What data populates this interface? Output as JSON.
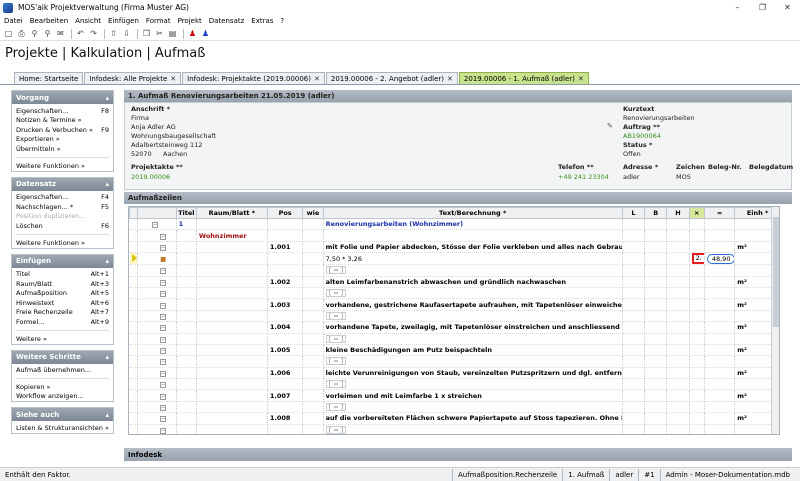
{
  "window": {
    "title": "MOS'aik Projektverwaltung (Firma Muster AG)"
  },
  "menu": [
    "Datei",
    "Bearbeiten",
    "Ansicht",
    "Einfügen",
    "Format",
    "Projekt",
    "Datensatz",
    "Extras",
    "?"
  ],
  "app_title": "Projekte | Kalkulation | Aufmaß",
  "tabs": [
    {
      "label": "Home: Startseite",
      "closable": false
    },
    {
      "label": "Infodesk: Alle Projekte",
      "closable": true
    },
    {
      "label": "Infodesk: Projektakte (2019.00006)",
      "closable": true
    },
    {
      "label": "2019.00006 - 2. Angebot (adler)",
      "closable": true
    },
    {
      "label": "2019.00006 - 1. Aufmaß (adler)",
      "closable": true
    }
  ],
  "sidebar": {
    "vorgang": {
      "title": "Vorgang",
      "items": [
        {
          "label": "Eigenschaften...",
          "key": "F8"
        },
        {
          "label": "Notizen & Termine »",
          "key": ""
        },
        {
          "label": "Drucken & Verbuchen »",
          "key": "F9"
        },
        {
          "label": "Exportieren »",
          "key": ""
        },
        {
          "label": "Übermitteln »",
          "key": ""
        }
      ],
      "more": "Weitere Funktionen »"
    },
    "datensatz": {
      "title": "Datensatz",
      "items": [
        {
          "label": "Eigenschaften...",
          "key": "F4"
        },
        {
          "label": "Nachschlagen... *",
          "key": "F5"
        },
        {
          "label": "Position duplizieren...",
          "key": ""
        },
        {
          "label": "Löschen",
          "key": "F6"
        }
      ],
      "more": "Weitere Funktionen »"
    },
    "einfuegen": {
      "title": "Einfügen",
      "items": [
        {
          "label": "Titel",
          "key": "Alt+1"
        },
        {
          "label": "Raum/Blatt",
          "key": "Alt+3"
        },
        {
          "label": "Aufmaßposition",
          "key": "Alt+5"
        },
        {
          "label": "Hinweistext",
          "key": "Alt+6"
        },
        {
          "label": "Freie Rechenzeile",
          "key": "Alt+7"
        },
        {
          "label": "Formel...",
          "key": "Alt+9"
        }
      ],
      "more": "Weitere »"
    },
    "schritte": {
      "title": "Weitere Schritte",
      "items": [
        {
          "label": "Aufmaß übernehmen..."
        },
        {
          "label": "Kopieren »"
        },
        {
          "label": "Workflow anzeigen..."
        }
      ]
    },
    "siehe": {
      "title": "Siehe auch",
      "items": [
        {
          "label": "Listen & Strukturansichten »"
        }
      ]
    }
  },
  "header_section": "1. Aufmaß Renovierungsarbeiten 21.05.2019 (adler)",
  "form": {
    "anschrift_label": "Anschrift *",
    "anschrift": [
      "Firma",
      "Anja Adler AG",
      "Wohnungsbaugesellschaft",
      "Adalbertsteinweg 112"
    ],
    "plz": "52070",
    "ort": "Aachen",
    "kurztext_label": "Kurztext",
    "kurztext": "Renovierungsarbeiten",
    "auftrag_label": "Auftrag **",
    "auftrag": "AB1900064",
    "status_label": "Status *",
    "status": "Offen",
    "projektakte_label": "Projektakte **",
    "projektakte": "2019.00006",
    "telefon_label": "Telefon **",
    "telefon": "+49 241 23304",
    "adresse_label": "Adresse *",
    "adresse": "adler",
    "zeichen_label": "Zeichen",
    "zeichen": "MOS",
    "belegnr_label": "Beleg-Nr.",
    "belegdatum_label": "Belegdatum"
  },
  "aufmass_section": "Aufmaßzeilen",
  "columns": [
    "",
    "",
    "Titel",
    "Raum/Blatt *",
    "Pos",
    "wie",
    "Text/Berechnung *",
    "L",
    "B",
    "H",
    "×",
    "=",
    "Einh *"
  ],
  "rows": [
    {
      "titel": "1",
      "raum": "",
      "pos": "",
      "text": "Renovierungsarbeiten (Wohnzimmer)",
      "style": "title",
      "einh": ""
    },
    {
      "titel": "",
      "raum": "Wohnzimmer",
      "pos": "",
      "text": "",
      "style": "room",
      "einh": ""
    },
    {
      "titel": "",
      "raum": "",
      "pos": "1.001",
      "text": "mit Folie und Papier abdecken, Stösse der Folie verkleben und alles nach Gebrauch entfer...",
      "style": "pos",
      "einh": "m²"
    },
    {
      "titel": "",
      "raum": "",
      "pos": "",
      "text": "7,50 * 3,26",
      "style": "calc",
      "factor": "2.",
      "result": "48,90",
      "einh": ""
    },
    {
      "titel": "",
      "raum": "",
      "pos": "",
      "text": "[ = ]",
      "style": "input",
      "einh": ""
    },
    {
      "titel": "",
      "raum": "",
      "pos": "1.002",
      "text": "alten Leimfarbenanstrich abwaschen und gründlich nachwaschen",
      "style": "pos",
      "einh": "m²"
    },
    {
      "titel": "",
      "raum": "",
      "pos": "",
      "text": "[ = ]",
      "style": "input",
      "einh": ""
    },
    {
      "titel": "",
      "raum": "",
      "pos": "1.003",
      "text": "vorhandene, gestrichene Raufasertapete aufrauhen, mit Tapetenlöser einweichen und a...",
      "style": "pos",
      "einh": "m²"
    },
    {
      "titel": "",
      "raum": "",
      "pos": "",
      "text": "[ = ]",
      "style": "input",
      "einh": ""
    },
    {
      "titel": "",
      "raum": "",
      "pos": "1.004",
      "text": "vorhandene Tapete, zweilagig, mit Tapetenlöser einstreichen und anschliessend entferne...",
      "style": "pos",
      "einh": "m²"
    },
    {
      "titel": "",
      "raum": "",
      "pos": "",
      "text": "[ = ]",
      "style": "input",
      "einh": ""
    },
    {
      "titel": "",
      "raum": "",
      "pos": "1.005",
      "text": "kleine Beschädigungen am Putz beispachteln",
      "style": "pos",
      "einh": "m²"
    },
    {
      "titel": "",
      "raum": "",
      "pos": "",
      "text": "[ = ]",
      "style": "input",
      "einh": ""
    },
    {
      "titel": "",
      "raum": "",
      "pos": "1.006",
      "text": "leichte Verunreinigungen von Staub, vereinzelten Putzspritzern und dgl. entfernen",
      "style": "pos",
      "einh": "m²"
    },
    {
      "titel": "",
      "raum": "",
      "pos": "",
      "text": "[ = ]",
      "style": "input",
      "einh": ""
    },
    {
      "titel": "",
      "raum": "",
      "pos": "1.007",
      "text": "vorleimen und mit Leimfarbe 1 x streichen",
      "style": "pos",
      "einh": "m²"
    },
    {
      "titel": "",
      "raum": "",
      "pos": "",
      "text": "[ = ]",
      "style": "input",
      "einh": ""
    },
    {
      "titel": "",
      "raum": "",
      "pos": "1.008",
      "text": "auf die vorbereiteten Flächen schwere Papiertapete auf Stoss tapezieren. Ohne Lieferung ...",
      "style": "pos",
      "einh": "m²"
    },
    {
      "titel": "",
      "raum": "",
      "pos": "",
      "text": "[ = ]",
      "style": "input",
      "einh": ""
    }
  ],
  "infodesk": "Infodesk",
  "status": {
    "hint": "Enthält den Faktor.",
    "context": "Aufmaßposition.Rechenzeile",
    "doc": "1. Aufmaß",
    "user": "adler",
    "num": "#1",
    "db": "Admin - Moser-Dokumentation.mdb"
  }
}
